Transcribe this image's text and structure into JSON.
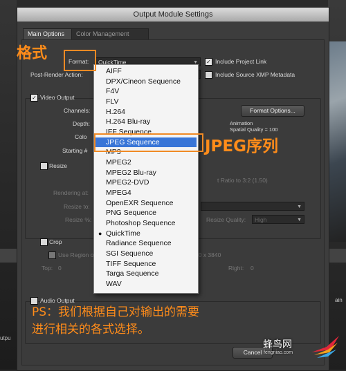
{
  "window": {
    "title": "Output Module Settings"
  },
  "tabs": [
    "Main Options",
    "Color Management"
  ],
  "main": {
    "format_label": "Format:",
    "format_value": "QuickTime",
    "post_render_label": "Post-Render Action:",
    "include_project_link": "Include Project Link",
    "include_xmp": "Include Source XMP Metadata",
    "video_output": "Video Output",
    "channels_label": "Channels:",
    "depth_label": "Depth:",
    "color_label": "Colo",
    "starting_label": "Starting #",
    "format_options_button": "Format Options...",
    "codec_name": "Animation",
    "spatial_quality": "Spatial Quality = 100",
    "resize": "Resize",
    "ratio_text": "t Ratio to 3:2 (1.50)",
    "rendering_at_label": "Rendering at:",
    "resize_to_label": "Resize to:",
    "resize_pct_label": "Resize %:",
    "resize_quality_label": "Resize Quality:",
    "resize_quality_value": "High",
    "crop": "Crop",
    "use_region": "Use Region o",
    "region_size": "60 x 3840",
    "top_label": "Top:",
    "top_value": "0",
    "right_label": "Right:",
    "right_value": "0",
    "audio_output": "Audio Output",
    "cancel_button": "Cancel"
  },
  "format_menu": {
    "items": [
      "AIFF",
      "DPX/Cineon Sequence",
      "F4V",
      "FLV",
      "H.264",
      "H.264 Blu-ray",
      "IFF Sequence",
      "JPEG Sequence",
      "MP3",
      "MPEG2",
      "MPEG2 Blu-ray",
      "MPEG2-DVD",
      "MPEG4",
      "OpenEXR Sequence",
      "PNG Sequence",
      "Photoshop Sequence",
      "QuickTime",
      "Radiance Sequence",
      "SGI Sequence",
      "TIFF Sequence",
      "Targa Sequence",
      "WAV"
    ],
    "highlighted": "JPEG Sequence",
    "checked": "QuickTime"
  },
  "annotations": {
    "format_zh": "格式",
    "jpeg_zh": "JPEG序列",
    "caption_line1": "PS：我们根据自己对输出的需要",
    "caption_line2": "进行相关的各式选择。"
  },
  "watermark": {
    "name": "蜂鸟网",
    "url": "fengniao.com"
  },
  "background": {
    "left_text": "utpu",
    "right_text": "ain"
  },
  "colors": {
    "annotation": "#f08a24",
    "highlight": "#3875d7"
  }
}
